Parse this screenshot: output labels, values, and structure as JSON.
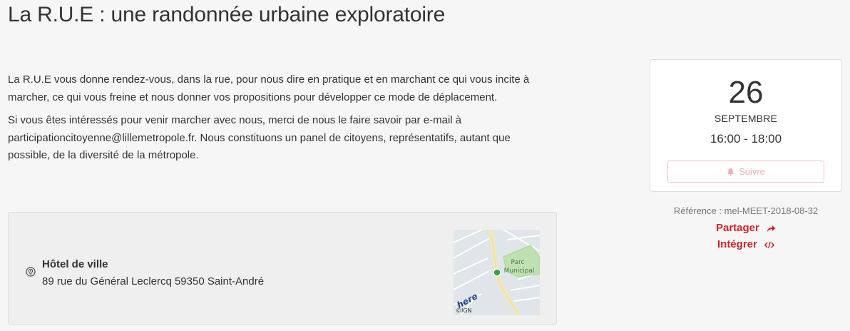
{
  "page": {
    "title": "La R.U.E : une randonnée urbaine exploratoire"
  },
  "description": {
    "paragraph_1": "La R.U.E vous donne rendez-vous, dans la rue, pour nous dire en pratique et en marchant ce qui vous incite à marcher, ce qui vous freine et nous donner vos propositions pour développer ce mode de déplacement.",
    "paragraph_2": "Si vous êtes intéressés pour venir marcher avec nous, merci de nous le faire savoir par e-mail à participationcitoyenne@lillemetropole.fr. Nous constituons un panel de citoyens, représentatifs, autant que possible, de la diversité de la métropole."
  },
  "location": {
    "icon": "map-pin-icon",
    "name": "Hôtel de ville",
    "address": "89 rue du Général Leclercq 59350 Saint-André",
    "map": {
      "park_label_line1": "Parc",
      "park_label_line2": "Municipal",
      "provider_logo": "here",
      "credit": "©IGN",
      "marker_color": "#2aa84a"
    }
  },
  "event_date": {
    "day": "26",
    "month": "SEPTEMBRE",
    "time": "16:00 - 18:00",
    "follow_label": "Suivre",
    "follow_icon": "bell-icon"
  },
  "sidebar": {
    "reference": "Référence : mel-MEET-2018-08-32",
    "share_label": "Partager",
    "share_icon": "share-arrow-icon",
    "embed_label": "Intégrer",
    "embed_icon": "code-icon"
  },
  "colors": {
    "accent": "#d2232a",
    "background": "#f6f6f6",
    "follow_disabled": "#f0b0b6"
  }
}
